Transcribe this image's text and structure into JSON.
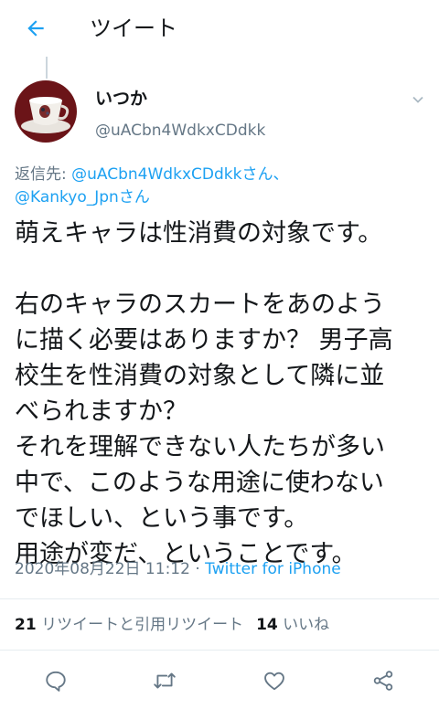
{
  "header": {
    "title": "ツイート",
    "back_icon": "arrow-left-icon"
  },
  "tweet": {
    "author": {
      "display_name": "いつか",
      "handle": "@uACbn4WdkxCDdkk"
    },
    "replying_to": {
      "prefix": "返信先: ",
      "mention_1": "@uACbn4WdkxCDdkkさん、",
      "mention_2": "@Kankyo_Jpnさん"
    },
    "text_lines": [
      "萌えキャラは性消費の対象です。",
      "",
      "右のキャラのスカートをあのよう",
      "に描く必要はありますか？ 男子高",
      "校生を性消費の対象として隣に並",
      "べられますか？",
      "それを理解できない人たちが多い",
      "中で、このような用途に使わない",
      "でほしい、という事です。",
      "用途が変だ、ということです。"
    ],
    "timestamp": "2020年08月22日 11:12",
    "separator": " · ",
    "source": "Twitter for iPhone"
  },
  "stats": {
    "retweets_count": "21",
    "retweets_label": " リツイートと引用リツイート",
    "likes_count": "14",
    "likes_label": " いいね"
  },
  "actions": [
    "reply-icon",
    "retweet-icon",
    "like-icon",
    "share-icon"
  ],
  "colors": {
    "accent": "#1da1f2",
    "text": "#14171a",
    "muted": "#657786",
    "divider": "#e6ecf0"
  }
}
